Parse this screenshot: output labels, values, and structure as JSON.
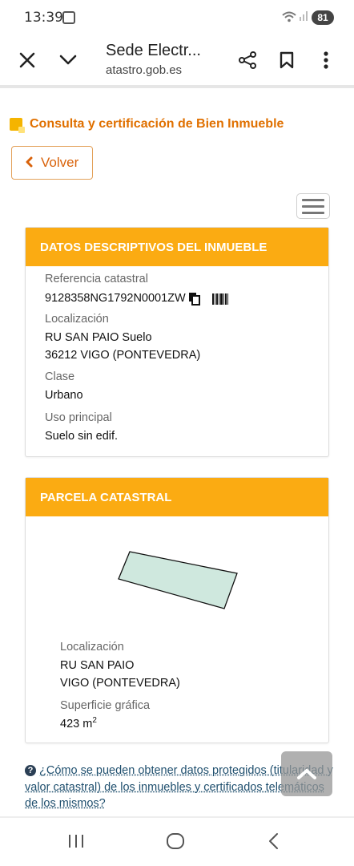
{
  "status_bar": {
    "time": "13:39",
    "battery": "81"
  },
  "toolbar": {
    "title": "Sede Electr...",
    "url": "atastro.gob.es"
  },
  "page": {
    "heading": "Consulta y certificación de Bien Inmueble",
    "back_label": "Volver"
  },
  "descriptive_panel": {
    "title": "DATOS DESCRIPTIVOS DEL INMUEBLE",
    "ref_label": "Referencia catastral",
    "ref_value": "9128358NG1792N0001ZW",
    "loc_label": "Localización",
    "loc_line1": "RU SAN PAIO Suelo",
    "loc_line2": "36212 VIGO (PONTEVEDRA)",
    "class_label": "Clase",
    "class_value": "Urbano",
    "use_label": "Uso principal",
    "use_value": "Suelo sin edif."
  },
  "parcel_panel": {
    "title": "PARCELA CATASTRAL",
    "loc_label": "Localización",
    "loc_line1": "RU SAN PAIO",
    "loc_line2": "VIGO (PONTEVEDRA)",
    "area_label": "Superficie gráfica",
    "area_value": "423 m",
    "area_unit_sup": "2"
  },
  "help": {
    "link_text": "¿Cómo se pueden obtener datos protegidos (titularidad y valor catastral) de los inmuebles y certificados telemáticos de los mismos?"
  },
  "colors": {
    "accent_orange": "#fbab12",
    "heading_orange": "#e07000",
    "parcel_fill": "#cfe8de"
  }
}
